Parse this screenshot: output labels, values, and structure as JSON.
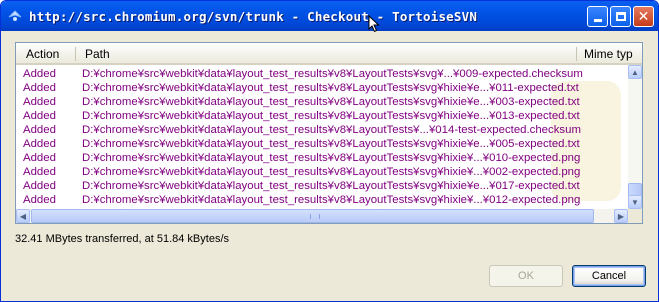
{
  "window": {
    "title": "http://src.chromium.org/svn/trunk - Checkout - TortoiseSVN",
    "app_icon": "tortoise-icon"
  },
  "list": {
    "columns": [
      "Action",
      "Path",
      "Mime typ"
    ],
    "rows": [
      {
        "action": "Added",
        "path": "D:¥chrome¥src¥webkit¥data¥layout_test_results¥v8¥LayoutTests¥svg¥...¥009-expected.checksum"
      },
      {
        "action": "Added",
        "path": "D:¥chrome¥src¥webkit¥data¥layout_test_results¥v8¥LayoutTests¥svg¥hixie¥e...¥011-expected.txt"
      },
      {
        "action": "Added",
        "path": "D:¥chrome¥src¥webkit¥data¥layout_test_results¥v8¥LayoutTests¥svg¥hixie¥e...¥003-expected.txt"
      },
      {
        "action": "Added",
        "path": "D:¥chrome¥src¥webkit¥data¥layout_test_results¥v8¥LayoutTests¥svg¥hixie¥e...¥013-expected.txt"
      },
      {
        "action": "Added",
        "path": "D:¥chrome¥src¥webkit¥data¥layout_test_results¥v8¥LayoutTests¥...¥014-test-expected.checksum"
      },
      {
        "action": "Added",
        "path": "D:¥chrome¥src¥webkit¥data¥layout_test_results¥v8¥LayoutTests¥svg¥hixie¥e...¥005-expected.txt"
      },
      {
        "action": "Added",
        "path": "D:¥chrome¥src¥webkit¥data¥layout_test_results¥v8¥LayoutTests¥svg¥hixie¥...¥010-expected.png"
      },
      {
        "action": "Added",
        "path": "D:¥chrome¥src¥webkit¥data¥layout_test_results¥v8¥LayoutTests¥svg¥hixie¥...¥002-expected.png"
      },
      {
        "action": "Added",
        "path": "D:¥chrome¥src¥webkit¥data¥layout_test_results¥v8¥LayoutTests¥svg¥hixie¥e...¥017-expected.txt"
      },
      {
        "action": "Added",
        "path": "D:¥chrome¥src¥webkit¥data¥layout_test_results¥v8¥LayoutTests¥svg¥hixie¥...¥012-expected.png"
      }
    ]
  },
  "status": {
    "text": "32.41 MBytes transferred, at 51.84 kBytes/s"
  },
  "buttons": {
    "ok": "OK",
    "cancel": "Cancel"
  },
  "colors": {
    "titlebar": "#0054e3",
    "added_text": "#800080",
    "dialog_bg": "#ece9d8"
  },
  "icons": [
    "tortoise-icon",
    "minimize-icon",
    "maximize-icon",
    "close-icon",
    "mouse-cursor-icon",
    "scroll-up-icon",
    "scroll-down-icon",
    "scroll-left-icon",
    "scroll-right-icon"
  ]
}
